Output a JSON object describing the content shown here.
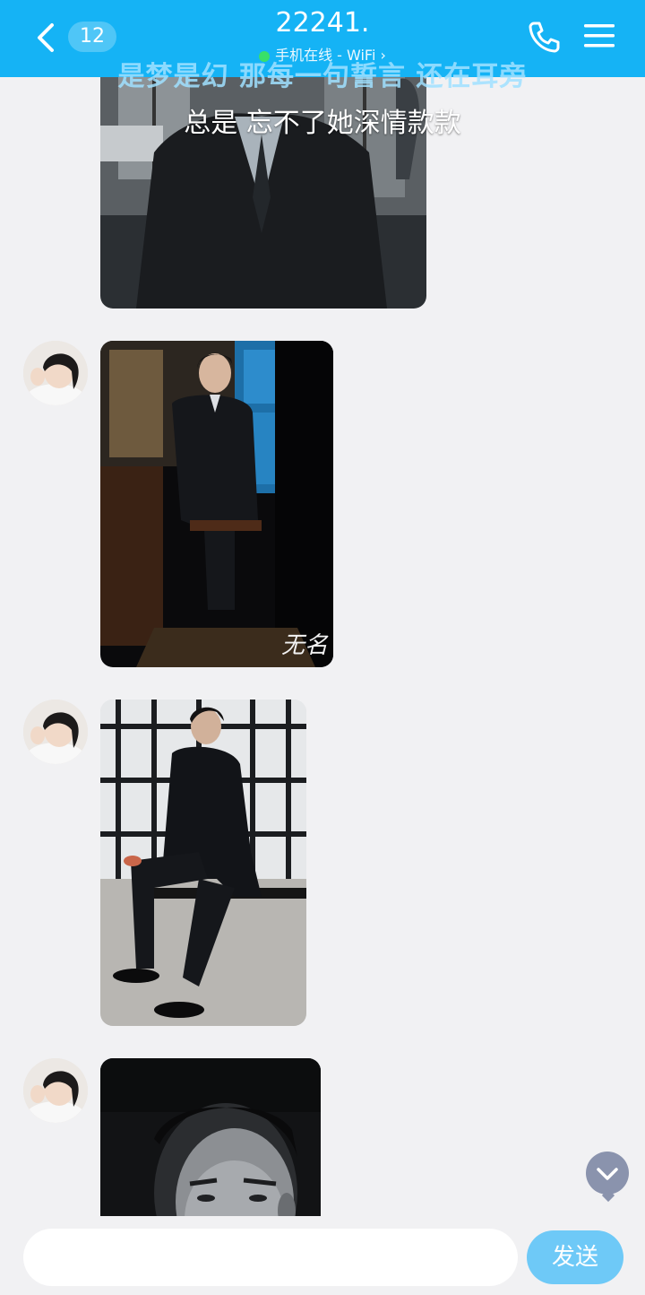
{
  "header": {
    "unread_count": "12",
    "title": "22241.",
    "status": "手机在线 - WiFi",
    "status_chevron": "›",
    "back_icon": "chevron-left-icon",
    "call_icon": "phone-icon",
    "menu_icon": "hamburger-menu-icon"
  },
  "lyrics": {
    "line1": "是梦是幻 那每一句誓言 还在耳旁",
    "line2": "总是 忘不了她深情款款"
  },
  "messages": [
    {
      "type": "image",
      "description_icon": "photo-man-in-suit-1"
    },
    {
      "type": "image",
      "description_icon": "photo-man-seated-phone",
      "watermark": "无名"
    },
    {
      "type": "image",
      "description_icon": "photo-man-sitting-bench"
    },
    {
      "type": "image",
      "description_icon": "photo-man-portrait-bw"
    }
  ],
  "composer": {
    "placeholder": "",
    "send_label": "发送"
  },
  "colors": {
    "header": "#15b3f5",
    "send_button": "#6ec9f7",
    "background": "#f1f1f3"
  }
}
